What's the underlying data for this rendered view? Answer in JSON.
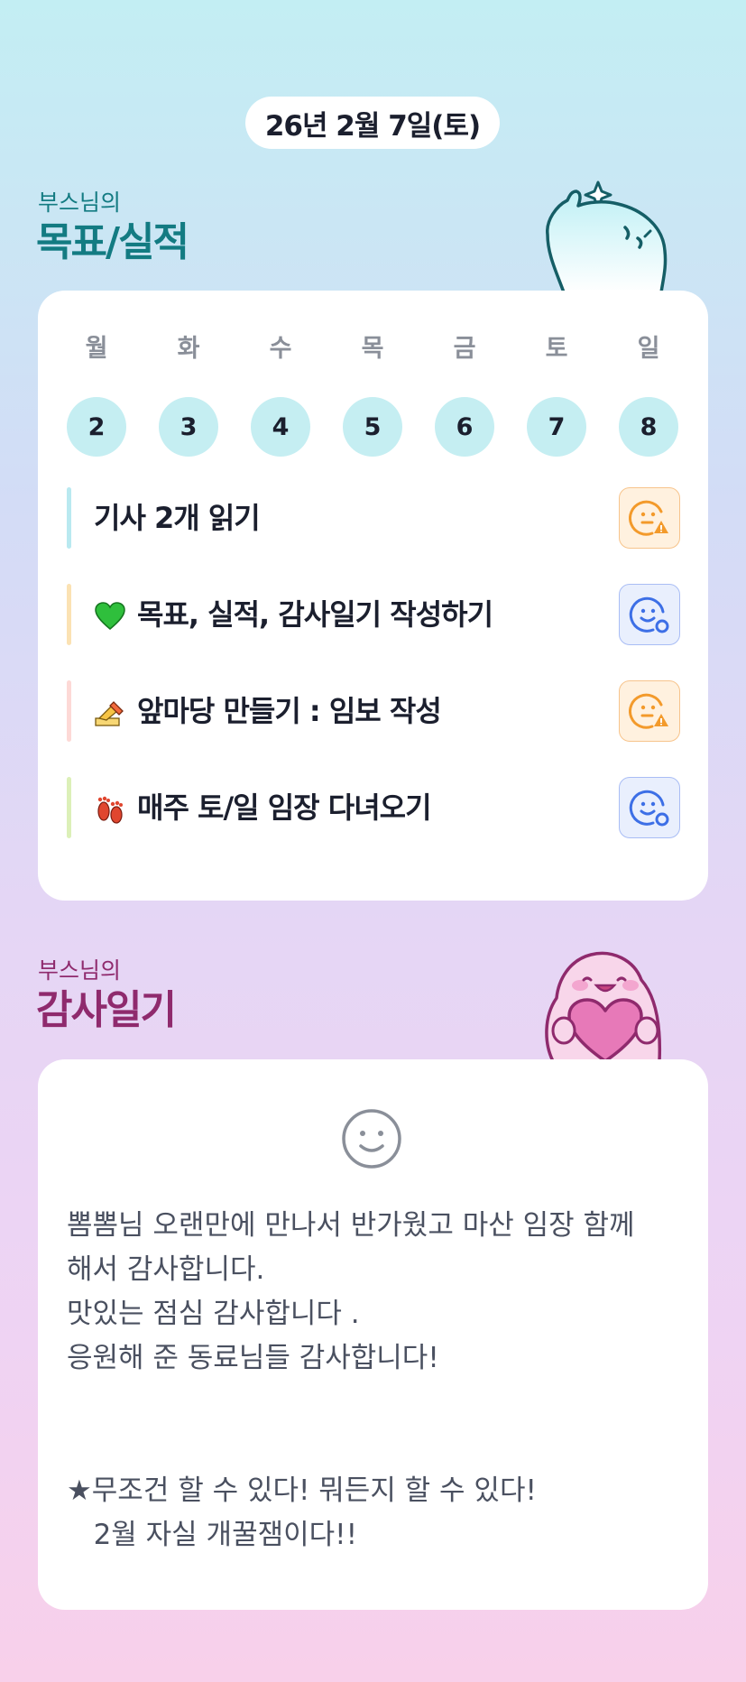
{
  "header": {
    "date": "26년 2월 7일(토)"
  },
  "goal_section": {
    "subtitle": "부스님의",
    "title": "목표/실적",
    "week": [
      {
        "day": "월",
        "date": "2"
      },
      {
        "day": "화",
        "date": "3"
      },
      {
        "day": "수",
        "date": "4"
      },
      {
        "day": "목",
        "date": "5"
      },
      {
        "day": "금",
        "date": "6"
      },
      {
        "day": "토",
        "date": "7"
      },
      {
        "day": "일",
        "date": "8"
      }
    ],
    "goals": [
      {
        "text": "기사 2개 읽기",
        "emoji": "",
        "bar_color": "#b9e9f0",
        "status": "warning-face-icon"
      },
      {
        "text": "목표, 실적, 감사일기 작성하기",
        "emoji": "green-heart-icon",
        "bar_color": "#fbe2b3",
        "status": "smile-face-icon"
      },
      {
        "text": "앞마당 만들기 : 임보 작성",
        "emoji": "writing-hand-icon",
        "bar_color": "#fdd9d6",
        "status": "warning-face-icon"
      },
      {
        "text": "매주 토/일 임장 다녀오기",
        "emoji": "footprints-icon",
        "bar_color": "#dcf0b8",
        "status": "smile-face-icon"
      }
    ]
  },
  "thanks_section": {
    "subtitle": "부스님의",
    "title": "감사일기",
    "mood_icon": "smiley-face-icon",
    "diary_text": "뽐뽐님 오랜만에 만나서 반가웠고 마산 임장 함께\n해서 감사합니다.\n맛있는 점심 감사합니다 .\n응원해 준 동료님들 감사합니다!\n\n\n★무조건 할 수 있다! 뭐든지 할 수 있다!\n   2월 자실 개꿀잼이다!!"
  },
  "colors": {
    "goal_accent": "#137b82",
    "thanks_accent": "#8f2a6d",
    "date_circle": "#c5eef2",
    "warning": "#f39a2b",
    "ok": "#3d6fe6"
  }
}
